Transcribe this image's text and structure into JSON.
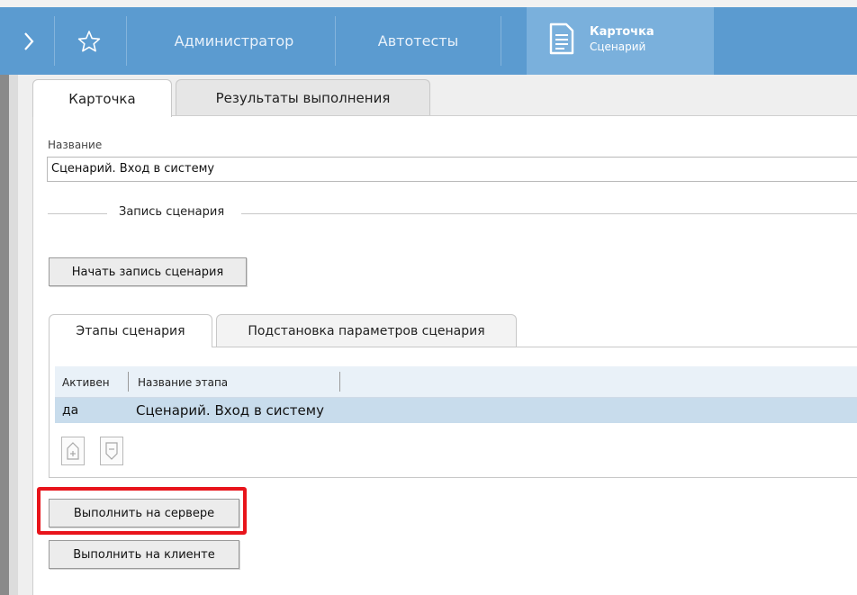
{
  "nav": {
    "items": [
      "Администратор",
      "Автотесты"
    ],
    "active_tab": {
      "title": "Карточка",
      "subtitle": "Сценарий"
    },
    "icons": {
      "expand": "chevron-right-icon",
      "favorites": "star-icon",
      "document": "document-icon"
    },
    "colors": {
      "bar": "#5b9bd0",
      "active": "#7ab0dc"
    }
  },
  "tabs": [
    "Карточка",
    "Результаты выполнения"
  ],
  "form": {
    "name_label": "Название",
    "name_value": "Сценарий. Вход в систему",
    "section_title": "Запись сценария",
    "record_button": "Начать запись сценария"
  },
  "subtabs": [
    "Этапы сценария",
    "Подстановка параметров сценария"
  ],
  "grid": {
    "columns": [
      "Активен",
      "Название этапа"
    ],
    "rows": [
      {
        "active": "да",
        "name": "Сценарий. Вход в систему"
      }
    ],
    "row_selected_color": "#c8dcec",
    "icons": {
      "add": "add-row-icon",
      "remove": "remove-row-icon"
    }
  },
  "actions": {
    "run_server": "Выполнить на сервере",
    "run_client": "Выполнить на клиенте",
    "highlight_color": "#e8141b"
  }
}
